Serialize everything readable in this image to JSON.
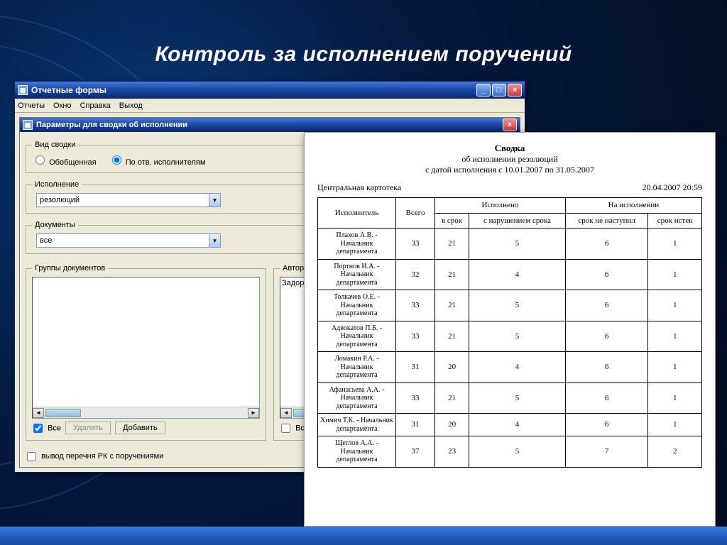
{
  "slide": {
    "title": "Контроль за исполнением поручений"
  },
  "outerWindow": {
    "title": "Отчетные формы",
    "menu": [
      "Отчеты",
      "Окно",
      "Справка",
      "Выход"
    ]
  },
  "dialog": {
    "title": "Параметры для сводки об исполнении",
    "groupKind": {
      "legend": "Вид сводки",
      "opt1": "Обобщенная",
      "opt2": "По отв. исполнителям"
    },
    "exec": {
      "legend": "Исполнение",
      "value": "резолюций"
    },
    "docs": {
      "legend": "Документы",
      "value": "все"
    },
    "groupDocs": {
      "legend": "Группы документов"
    },
    "authors": {
      "legend": "Авторы резолюций",
      "item0": "Задорнов М.М."
    },
    "allLabel": "Все",
    "deleteLabel": "Удалить",
    "addLabel": "Добавить",
    "outputChk": "вывод перечня РК с поручениями"
  },
  "report": {
    "title": "Сводка",
    "sub1": "об исполнении резолюций",
    "sub2": "с датой исполнения с 10.01.2007 по 31.05.2007",
    "place": "Центральная картотека",
    "timestamp": "20.04.2007 20:59",
    "colExecutor": "Исполнитель",
    "colTotal": "Всего",
    "colDone": "Исполнено",
    "colPending": "На исполнении",
    "colOnTime": "в срок",
    "colLate": "с нарушением срока",
    "colNotDue": "срок не наступил",
    "colOverdue": "срок истек",
    "rows": [
      {
        "exec": "Плахов А.В. - Начальник департамента",
        "total": 33,
        "ontime": 21,
        "late": 5,
        "notdue": 6,
        "overdue": 1
      },
      {
        "exec": "Портнов И.А. - Начальник департамента",
        "total": 32,
        "ontime": 21,
        "late": 4,
        "notdue": 6,
        "overdue": 1
      },
      {
        "exec": "Толкачев О.Е. - Начальник департамента",
        "total": 33,
        "ontime": 21,
        "late": 5,
        "notdue": 6,
        "overdue": 1
      },
      {
        "exec": "Адвокатов П.Б. - Начальник департамента",
        "total": 33,
        "ontime": 21,
        "late": 5,
        "notdue": 6,
        "overdue": 1
      },
      {
        "exec": "Ломакин Р.А. - Начальник департамента",
        "total": 31,
        "ontime": 20,
        "late": 4,
        "notdue": 6,
        "overdue": 1
      },
      {
        "exec": "Афанасьева А.А. - Начальник департамента",
        "total": 33,
        "ontime": 21,
        "late": 5,
        "notdue": 6,
        "overdue": 1
      },
      {
        "exec": "Химич Т.К. - Начальник департамента",
        "total": 31,
        "ontime": 20,
        "late": 4,
        "notdue": 6,
        "overdue": 1
      },
      {
        "exec": "Щеглов А.А. - Начальник департамента",
        "total": 37,
        "ontime": 23,
        "late": 5,
        "notdue": 7,
        "overdue": 2
      }
    ]
  }
}
